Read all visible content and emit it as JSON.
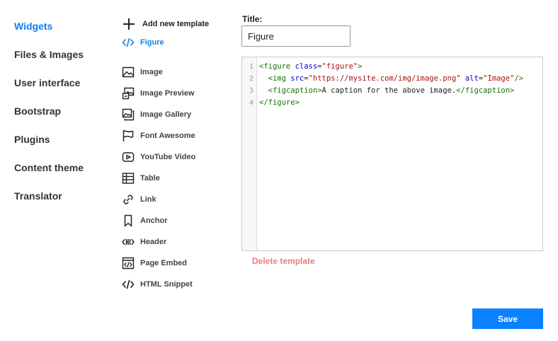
{
  "nav": {
    "items": [
      {
        "label": "Widgets"
      },
      {
        "label": "Files & Images"
      },
      {
        "label": "User interface"
      },
      {
        "label": "Bootstrap"
      },
      {
        "label": "Plugins"
      },
      {
        "label": "Content theme"
      },
      {
        "label": "Translator"
      }
    ]
  },
  "templates": {
    "add_label": "Add new template",
    "items": [
      {
        "label": "Figure",
        "icon": "code-icon"
      },
      {
        "label": "Image",
        "icon": "image-icon"
      },
      {
        "label": "Image Preview",
        "icon": "image-preview-icon"
      },
      {
        "label": "Image Gallery",
        "icon": "image-gallery-icon"
      },
      {
        "label": "Font Awesome",
        "icon": "flag-icon"
      },
      {
        "label": "YouTube Video",
        "icon": "play-icon"
      },
      {
        "label": "Table",
        "icon": "table-icon"
      },
      {
        "label": "Link",
        "icon": "link-icon"
      },
      {
        "label": "Anchor",
        "icon": "bookmark-icon"
      },
      {
        "label": "Header",
        "icon": "header-icon"
      },
      {
        "label": "Page Embed",
        "icon": "embed-icon"
      },
      {
        "label": "HTML Snippet",
        "icon": "code-icon"
      }
    ]
  },
  "editor": {
    "title_label": "Title:",
    "title_value": "Figure",
    "line_numbers": [
      "1",
      "2",
      "3",
      "4"
    ],
    "code": {
      "l1_open": "<figure",
      "l1_attr": "class",
      "l1_eq": "=",
      "l1_val": "\"figure\"",
      "l1_close": ">",
      "l2_indent": "  ",
      "l2_open": "<img",
      "l2_attr1": "src",
      "l2_eq1": "=",
      "l2_val1": "\"https://mysite.com/img/image.png\"",
      "l2_attr2": "alt",
      "l2_eq2": "=",
      "l2_val2": "\"Image\"",
      "l2_close": "/>",
      "l3_indent": "  ",
      "l3_open": "<figcaption>",
      "l3_text": "A caption for the above image.",
      "l3_close": "</figcaption>",
      "l4_close": "</figure>"
    },
    "delete_label": "Delete template",
    "save_label": "Save"
  },
  "colors": {
    "accent": "#0a82ff",
    "active_text": "#0b7ff2",
    "delete": "#f07a78"
  }
}
